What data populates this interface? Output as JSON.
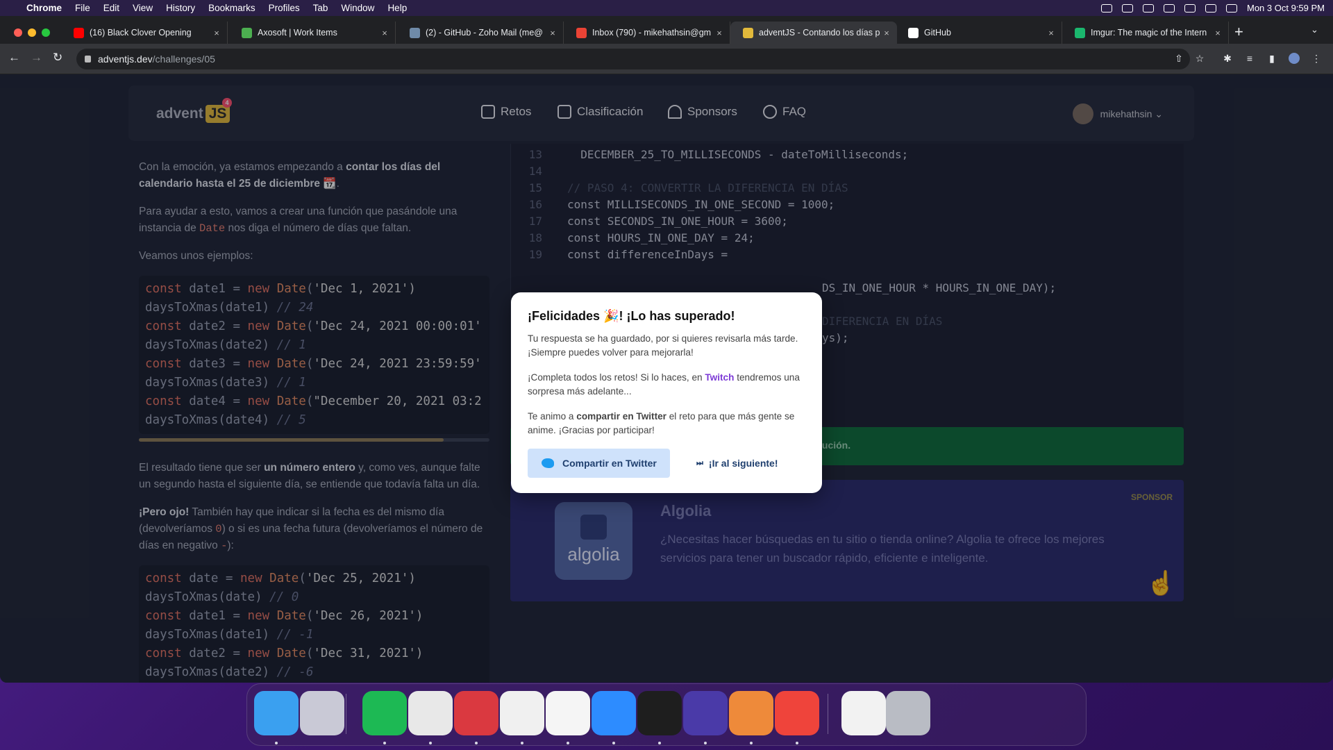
{
  "menubar": {
    "app": "Chrome",
    "items": [
      "File",
      "Edit",
      "View",
      "History",
      "Bookmarks",
      "Profiles",
      "Tab",
      "Window",
      "Help"
    ],
    "datetime": "Mon 3 Oct  9:59 PM"
  },
  "tabs": [
    {
      "title": "(16) Black Clover Opening",
      "icon": "youtube-icon",
      "color": "#ff0000"
    },
    {
      "title": "Axosoft | Work Items",
      "icon": "axosoft-icon",
      "color": "#4caf50"
    },
    {
      "title": "(2) - GitHub - Zoho Mail (me@",
      "icon": "zoho-mail-icon",
      "color": "#6f8aa8"
    },
    {
      "title": "Inbox (790) - mikehathsin@gm",
      "icon": "gmail-icon",
      "color": "#ea4335"
    },
    {
      "title": "adventJS - Contando los días p",
      "icon": "adventjs-icon",
      "color": "#e2b93b",
      "active": true
    },
    {
      "title": "GitHub",
      "icon": "github-icon",
      "color": "#ffffff"
    },
    {
      "title": "Imgur: The magic of the Intern",
      "icon": "imgur-icon",
      "color": "#1bb76e"
    }
  ],
  "address": {
    "domain": "adventjs.dev",
    "path": "/challenges/05"
  },
  "site": {
    "logo_text": "advent",
    "logo_js": "JS",
    "logo_badge": "4",
    "nav": [
      {
        "label": "Retos",
        "icon": "puzzle-icon"
      },
      {
        "label": "Clasificación",
        "icon": "chart-icon"
      },
      {
        "label": "Sponsors",
        "icon": "star-icon"
      },
      {
        "label": "FAQ",
        "icon": "help-icon"
      }
    ],
    "username": "mikehathsin"
  },
  "article": {
    "p1_a": "Con la emoción, ya estamos empezando a ",
    "p1_b": "contar los días del calendario hasta el 25 de diciembre",
    "p1_c": " 📆.",
    "p2_a": "Para ayudar a esto, vamos a crear una función que pasándole una instancia de ",
    "p2_code": "Date",
    "p2_b": " nos diga el número de días que faltan.",
    "p3": "Veamos unos ejemplos:",
    "p4_a": "El resultado tiene que ser ",
    "p4_b": "un número entero",
    "p4_c": " y, como ves, aunque falte un segundo hasta el siguiente día, se entiende que todavía falta un día.",
    "p5_a": "¡Pero ojo!",
    "p5_b": " También hay que indicar si la fecha es del mismo día (devolveríamos ",
    "p5_code1": "0",
    "p5_c": ") o si es una fecha futura (devolveríamos el número de días en negativo ",
    "p5_code2": "-",
    "p5_d": "):"
  },
  "code1": [
    {
      "v": "date1",
      "d": "'Dec 1, 2021')",
      "r": "// 24",
      "a": "date1"
    },
    {
      "v": "date2",
      "d": "'Dec 24, 2021 00:00:01'",
      "r": "// 1",
      "a": "date2"
    },
    {
      "v": "date3",
      "d": "'Dec 24, 2021 23:59:59'",
      "r": "// 1",
      "a": "date3"
    },
    {
      "v": "date4",
      "d": "\"December 20, 2021 03:2",
      "r": "// 5",
      "a": "date4"
    }
  ],
  "code2": [
    {
      "v": "date",
      "d": "'Dec 25, 2021')",
      "r": "// 0",
      "a": "date"
    },
    {
      "v": "date1",
      "d": "'Dec 26, 2021')",
      "r": "// -1",
      "a": "date1"
    },
    {
      "v": "date2",
      "d": "'Dec 31, 2021')",
      "r": "// -6",
      "a": "date2"
    }
  ],
  "editor": {
    "lines": [
      {
        "n": "13",
        "t": "  DECEMBER_25_TO_MILLISECONDS - dateToMilliseconds;"
      },
      {
        "n": "14",
        "t": ""
      },
      {
        "n": "15",
        "t": "// PASO 4: CONVERTIR LA DIFERENCIA EN DÍAS"
      },
      {
        "n": "16",
        "t": "const MILLISECONDS_IN_ONE_SECOND = 1000;"
      },
      {
        "n": "17",
        "t": "const SECONDS_IN_ONE_HOUR = 3600;"
      },
      {
        "n": "18",
        "t": "const HOURS_IN_ONE_DAY = 24;"
      },
      {
        "n": "19",
        "t": "const differenceInDays ="
      }
    ],
    "partial1": "DS_IN_ONE_HOUR * HOURS_IN_ONE_DAY);",
    "partial2": "DIFERENCIA EN DÍAS",
    "partial3": "ys);",
    "success_partial": "lución."
  },
  "sponsor": {
    "label": "SPONSOR",
    "logo_word": "algolia",
    "name": "Algolia",
    "desc": "¿Necesitas hacer búsquedas en tu sitio o tienda online? Algolia te ofrece los mejores servicios para tener un buscador rápido, eficiente e inteligente."
  },
  "modal": {
    "title": "¡Felicidades 🎉! ¡Lo has superado!",
    "p1": "Tu respuesta se ha guardado, por si quieres revisarla más tarde. ¡Siempre puedes volver para mejorarla!",
    "p2_a": "¡Completa todos los retos! Si lo haces, en ",
    "p2_link": "Twitch",
    "p2_b": " tendremos una sorpresa más adelante...",
    "p3_a": "Te animo a ",
    "p3_b": "compartir en Twitter",
    "p3_c": " el reto para que más gente se anime. ¡Gracias por participar!",
    "share_label": "Compartir en Twitter",
    "next_label": "¡Ir al siguiente!"
  },
  "dock": [
    {
      "name": "finder-icon",
      "color": "#3aa0f0"
    },
    {
      "name": "launchpad-icon",
      "color": "#c9c9d6"
    },
    {
      "name": "spotify-icon",
      "color": "#1db954"
    },
    {
      "name": "chrome-icon",
      "color": "#e8e8e8"
    },
    {
      "name": "expressvpn-icon",
      "color": "#da3940"
    },
    {
      "name": "vscode-icon",
      "color": "#f0f0f0"
    },
    {
      "name": "slack-icon",
      "color": "#f5f5f5"
    },
    {
      "name": "zoom-icon",
      "color": "#2d8cff"
    },
    {
      "name": "terminal-icon",
      "color": "#1e1e1e"
    },
    {
      "name": "app-purple-icon",
      "color": "#4a3aa8"
    },
    {
      "name": "openvpn-icon",
      "color": "#ee8a3a"
    },
    {
      "name": "anydesk-icon",
      "color": "#ef443b"
    },
    {
      "name": "preview-window-icon",
      "color": "#f2f2f2"
    },
    {
      "name": "trash-icon",
      "color": "#b9bcc4"
    }
  ]
}
